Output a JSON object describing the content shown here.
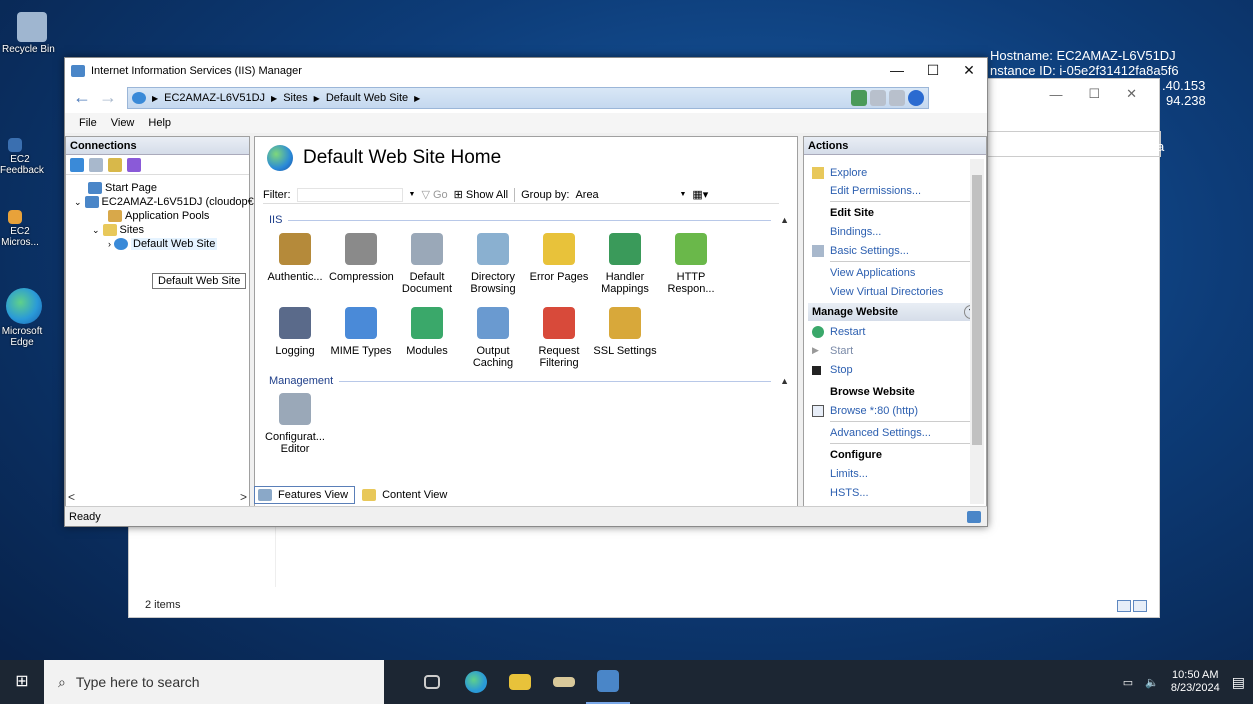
{
  "desktop": {
    "icons": [
      {
        "label": "Recycle Bin",
        "color": "#9fb6d0"
      },
      {
        "label": "EC2 Feedback",
        "color": "#3a6fb0"
      },
      {
        "label": "EC2 Micros...",
        "color": "#e8a23a"
      },
      {
        "label": "Microsoft Edge",
        "color": "#2a9ad8"
      }
    ],
    "bginfo": [
      "Hostname: EC2AMAZ-L6V51DJ",
      "nstance ID: i-05e2f31412fa8a5f6",
      ".40.153",
      "94.238"
    ],
    "bg_side_text": "a"
  },
  "bg_explorer": {
    "status": "2 items"
  },
  "iis": {
    "title": "Internet Information Services (IIS) Manager",
    "controls": [
      "—",
      "☐",
      "✕"
    ],
    "address": {
      "segments": [
        "EC2AMAZ-L6V51DJ",
        "Sites",
        "Default Web Site"
      ]
    },
    "menu": [
      "File",
      "View",
      "Help"
    ],
    "connections": {
      "header": "Connections",
      "tree": {
        "start_page": "Start Page",
        "server": "EC2AMAZ-L6V51DJ (cloudop€",
        "app_pools": "Application Pools",
        "sites": "Sites",
        "default_site": "Default Web Site"
      },
      "tooltip": "Default Web Site",
      "scroll_left": "<",
      "scroll_right": ">"
    },
    "main": {
      "title": "Default Web Site Home",
      "filter_label": "Filter:",
      "go_label": "Go",
      "show_all_label": "Show All",
      "groupby_label": "Group by:",
      "groupby_value": "Area",
      "group_iis": "IIS",
      "group_management": "Management",
      "features_iis": [
        {
          "label": "Authentic...",
          "color": "#b58a3a"
        },
        {
          "label": "Compression",
          "color": "#8a8a8a"
        },
        {
          "label": "Default Document",
          "color": "#9aa8b8"
        },
        {
          "label": "Directory Browsing",
          "color": "#8ab0d0"
        },
        {
          "label": "Error Pages",
          "color": "#e8c23a"
        },
        {
          "label": "Handler Mappings",
          "color": "#3a9a5a"
        },
        {
          "label": "HTTP Respon...",
          "color": "#6ab84a"
        },
        {
          "label": "Logging",
          "color": "#5a6a8a"
        },
        {
          "label": "MIME Types",
          "color": "#4a8ad8"
        },
        {
          "label": "Modules",
          "color": "#3aa86a"
        },
        {
          "label": "Output Caching",
          "color": "#6a9ad0"
        },
        {
          "label": "Request Filtering",
          "color": "#d84a3a"
        },
        {
          "label": "SSL Settings",
          "color": "#d8a83a"
        }
      ],
      "features_mgmt": [
        {
          "label": "Configurat... Editor",
          "color": "#9aa8b8"
        }
      ],
      "tab_features": "Features View",
      "tab_content": "Content View"
    },
    "actions": {
      "header": "Actions",
      "explore": "Explore",
      "edit_permissions": "Edit Permissions...",
      "edit_site": "Edit Site",
      "bindings": "Bindings...",
      "basic_settings": "Basic Settings...",
      "view_applications": "View Applications",
      "view_vdirs": "View Virtual Directories",
      "manage_website": "Manage Website",
      "restart": "Restart",
      "start": "Start",
      "stop": "Stop",
      "browse_website": "Browse Website",
      "browse_80": "Browse *:80 (http)",
      "advanced_settings": "Advanced Settings...",
      "configure": "Configure",
      "limits": "Limits...",
      "hsts": "HSTS..."
    },
    "status": "Ready"
  },
  "taskbar": {
    "search_placeholder": "Type here to search",
    "time": "10:50 AM",
    "date": "8/23/2024"
  }
}
